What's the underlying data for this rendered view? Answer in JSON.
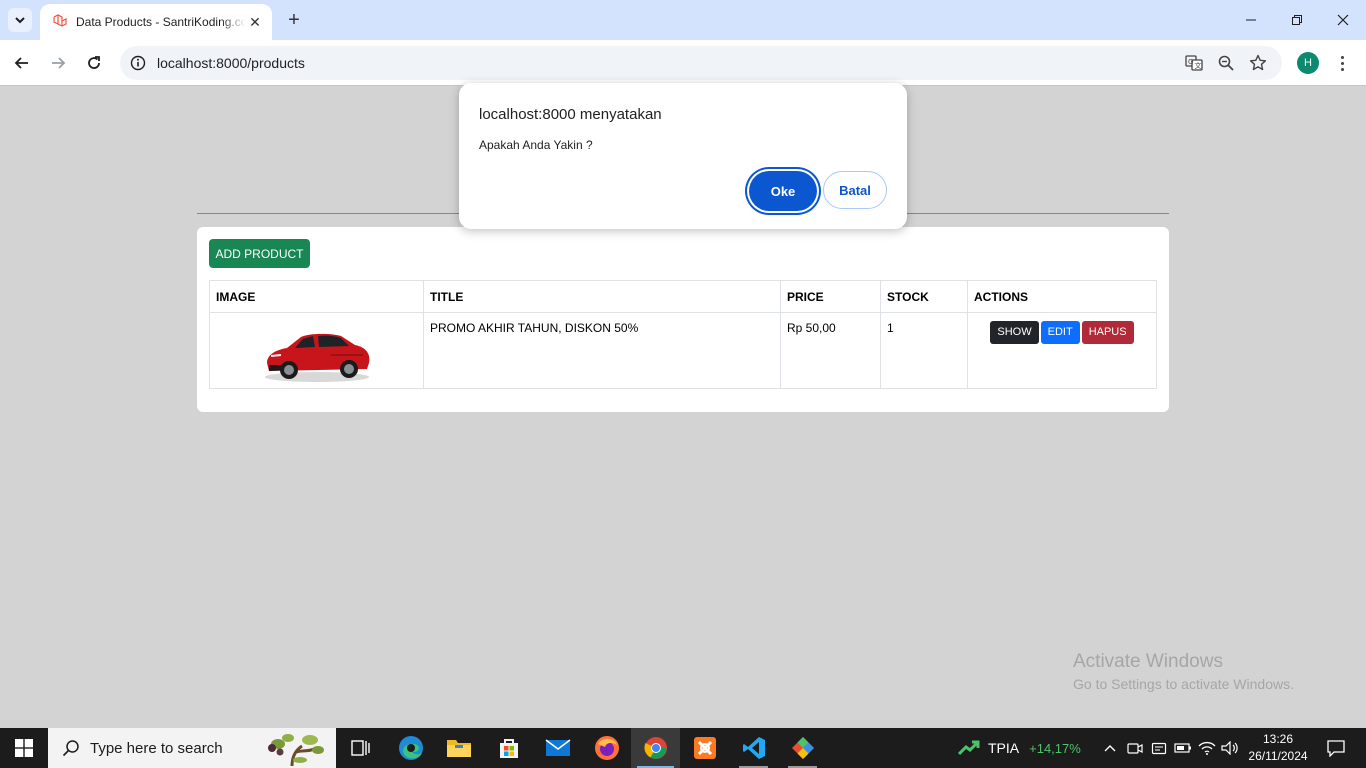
{
  "browser": {
    "tab_title": "Data Products - SantriKoding.com",
    "url": "localhost:8000/products",
    "profile_initial": "H"
  },
  "page": {
    "add_button": "ADD PRODUCT",
    "table": {
      "headers": [
        "IMAGE",
        "TITLE",
        "PRICE",
        "STOCK",
        "ACTIONS"
      ],
      "rows": [
        {
          "title": "PROMO AKHIR TAHUN, DISKON 50%",
          "price": "Rp 50,00",
          "stock": "1"
        }
      ]
    },
    "actions": {
      "show": "SHOW",
      "edit": "EDIT",
      "delete": "HAPUS"
    }
  },
  "dialog": {
    "title": "localhost:8000 menyatakan",
    "message": "Apakah Anda Yakin ?",
    "ok": "Oke",
    "cancel": "Batal"
  },
  "watermark": {
    "line1": "Activate Windows",
    "line2": "Go to Settings to activate Windows."
  },
  "taskbar": {
    "search_placeholder": "Type here to search",
    "stock_name": "TPIA",
    "stock_change": "+14,17%",
    "time": "13:26",
    "date": "26/11/2024"
  },
  "colors": {
    "add_button": "#198754",
    "show": "#212529",
    "edit": "#0d6efd",
    "delete": "#b02a37",
    "dialog_primary": "#0b57d0"
  }
}
